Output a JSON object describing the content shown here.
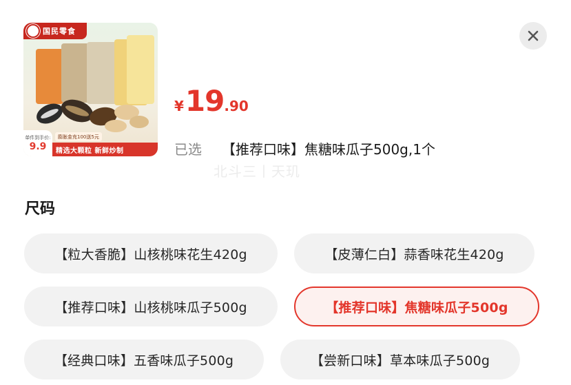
{
  "product": {
    "image_brand_text": "国民零食",
    "image_badge_label": "单件到手价:",
    "image_badge_price": "9.9",
    "image_promo_tag": "膨胀金充100送5元",
    "image_strip_text": "精选大颗粒 新鲜炒制",
    "currency_symbol": "¥",
    "price_integer": "19",
    "price_decimal": ".90"
  },
  "selection": {
    "label": "已选",
    "value": "【推荐口味】焦糖味瓜子500g,1个"
  },
  "watermark_text": "北斗三丨天玑",
  "variant_section": {
    "title": "尺码",
    "options": [
      {
        "label": "【粒大香脆】山核桃味花生420g",
        "selected": false
      },
      {
        "label": "【皮薄仁白】蒜香味花生420g",
        "selected": false
      },
      {
        "label": "【推荐口味】山核桃味瓜子500g",
        "selected": false
      },
      {
        "label": "【推荐口味】焦糖味瓜子500g",
        "selected": true
      },
      {
        "label": "【经典口味】五香味瓜子500g",
        "selected": false
      },
      {
        "label": "【尝新口味】草本味瓜子500g",
        "selected": false
      }
    ]
  },
  "colors": {
    "accent_red": "#e3362b",
    "chip_background": "#f2f2f2",
    "chip_selected_background": "#fdf1ef",
    "muted_text": "#8a8a8a"
  },
  "icons": {
    "close": "close-icon"
  }
}
